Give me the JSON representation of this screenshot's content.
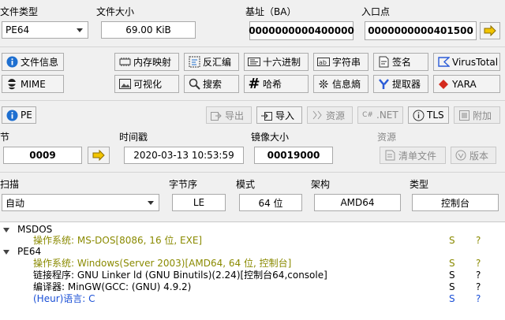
{
  "labels": {
    "file_type": "文件类型",
    "file_size": "文件大小",
    "base_address": "基址（BA）",
    "entry_point": "入口点",
    "section": "节",
    "timestamp": "时间戳",
    "image_size": "镜像大小",
    "resources": "资源",
    "scan": "扫描",
    "endianness": "字节序",
    "mode": "模式",
    "architecture": "架构",
    "type": "类型"
  },
  "values": {
    "file_type": "PE64",
    "file_size": "69.00 KiB",
    "base_address": "0000000000400000",
    "entry_point": "0000000000401500",
    "section": "0009",
    "timestamp": "2020-03-13 10:53:59",
    "image_size": "00019000",
    "scan": "自动",
    "endianness": "LE",
    "mode": "64 位",
    "architecture": "AMD64",
    "type": "控制台"
  },
  "toolbar": {
    "file_info": "文件信息",
    "memory_map": "内存映射",
    "disassembly": "反汇编",
    "hex": "十六进制",
    "strings": "字符串",
    "signatures": "签名",
    "virustotal": "VirusTotal",
    "mime": "MIME",
    "visualization": "可视化",
    "search": "搜索",
    "hash": "哈希",
    "entropy": "信息熵",
    "extractor": "提取器",
    "yara": "YARA"
  },
  "pe_bar": {
    "pe": "PE",
    "export": "导出",
    "import": "导入",
    "resources": "资源",
    "net": ".NET",
    "tls": "TLS",
    "overlay": "附加"
  },
  "res_buttons": {
    "manifest": "清单文件",
    "version": "版本"
  },
  "tree": {
    "msdos": "MSDOS",
    "msdos_os": "操作系统: MS-DOS[8086, 16 位, EXE]",
    "pe64": "PE64",
    "pe64_os": "操作系统: Windows(Server 2003)[AMD64, 64 位, 控制台]",
    "linker": "链接程序: GNU Linker ld (GNU Binutils)(2.24)[控制台64,console]",
    "compiler": "编译器: MinGW(GCC: (GNU) 4.9.2)",
    "language": "(Heur)语言: C",
    "s": "S",
    "q": "?"
  },
  "colors": {
    "olive": "#8a8a00",
    "heuristic_blue": "#1a4fd6",
    "arrow_yellow": "#f2c500"
  }
}
